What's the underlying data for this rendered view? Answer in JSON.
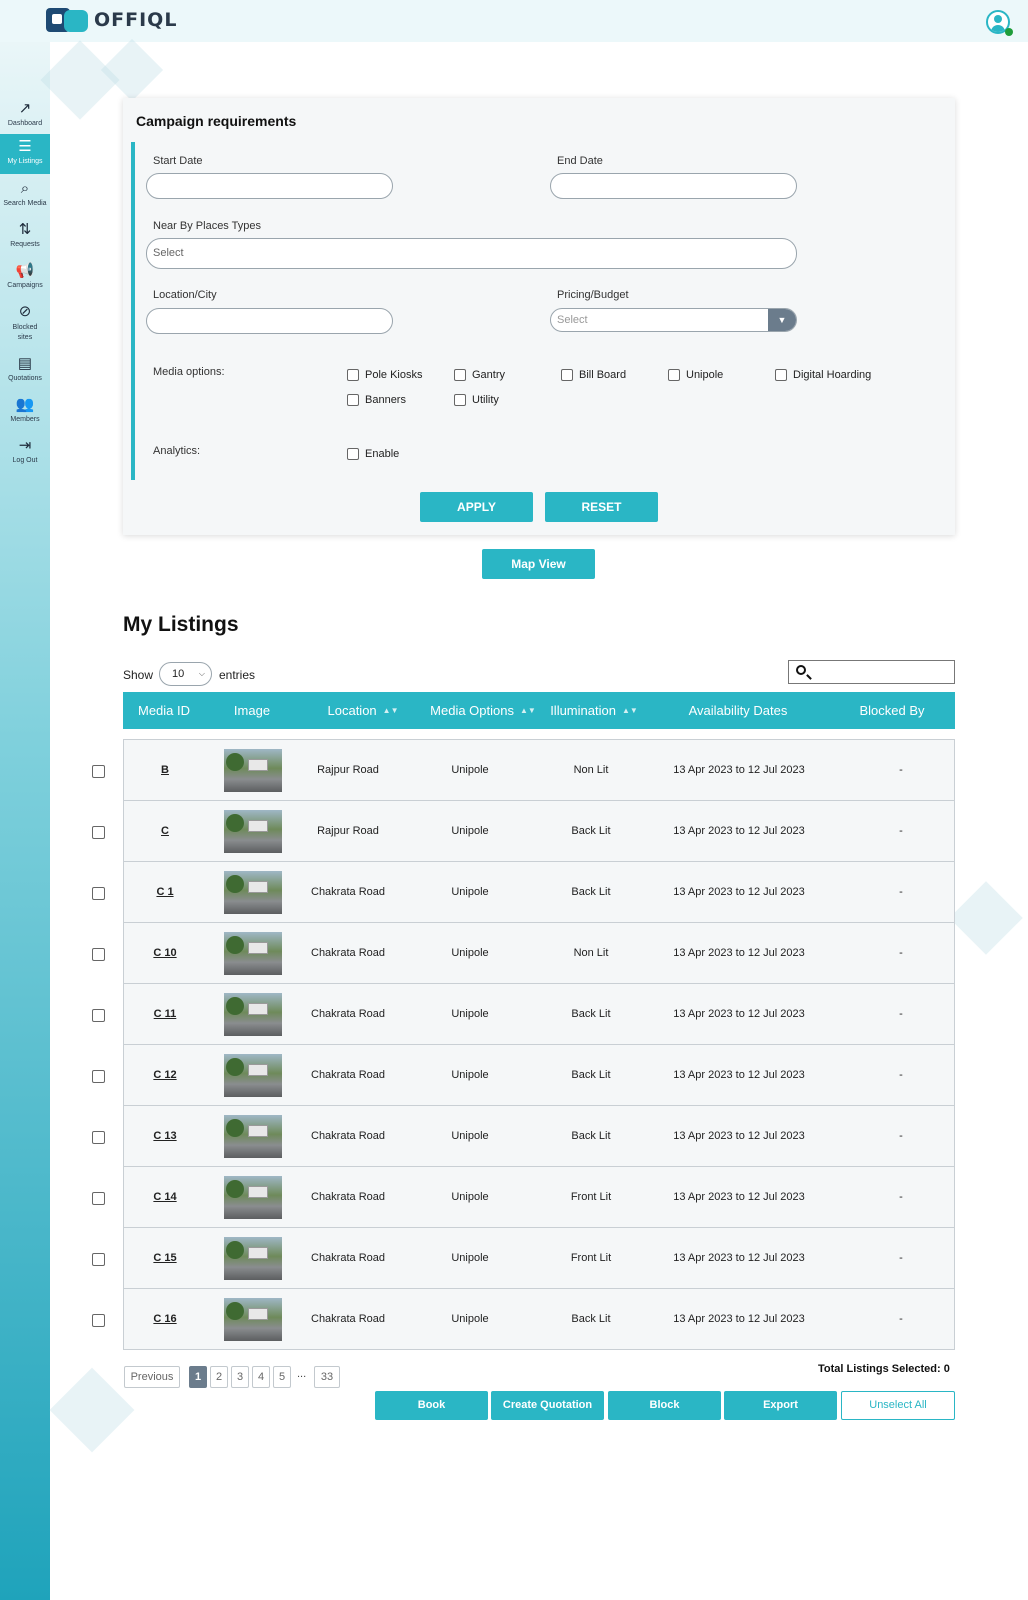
{
  "brand": {
    "name": "OFFIQL"
  },
  "sidebar": {
    "items": [
      {
        "key": "dashboard",
        "label": "Dashboard",
        "icon": "trending-up-icon"
      },
      {
        "key": "my-listings",
        "label": "My Listings",
        "icon": "list-icon",
        "active": true
      },
      {
        "key": "search-media",
        "label": "Search Media",
        "icon": "search-icon"
      },
      {
        "key": "requests",
        "label": "Requests",
        "icon": "sort-list-icon"
      },
      {
        "key": "campaigns",
        "label": "Campaigns",
        "icon": "megaphone-icon"
      },
      {
        "key": "blocked-sites",
        "label": "Blocked sites",
        "icon": "blocked-icon"
      },
      {
        "key": "quotations",
        "label": "Quotations",
        "icon": "invoice-icon"
      },
      {
        "key": "members",
        "label": "Members",
        "icon": "group-icon"
      },
      {
        "key": "log-out",
        "label": "Log Out",
        "icon": "logout-icon"
      }
    ]
  },
  "campaign": {
    "title": "Campaign requirements",
    "start_date_label": "Start Date",
    "start_date_value": "",
    "end_date_label": "End Date",
    "end_date_value": "",
    "nearby_label": "Near By Places Types",
    "nearby_placeholder": "Select",
    "location_label": "Location/City",
    "location_value": "",
    "pricing_label": "Pricing/Budget",
    "pricing_placeholder": "Select",
    "media_options_label": "Media options:",
    "media_options": [
      "Pole Kiosks",
      "Gantry",
      "Bill Board",
      "Unipole",
      "Digital Hoarding",
      "Banners",
      "Utility"
    ],
    "analytics_label": "Analytics:",
    "analytics_option": "Enable",
    "apply_label": "APPLY",
    "reset_label": "RESET"
  },
  "map_view_label": "Map View",
  "listings": {
    "title": "My Listings",
    "show_label": "Show",
    "entries_value": "10",
    "entries_label": "entries",
    "columns": [
      "Media ID",
      "Image",
      "Location",
      "Media Options",
      "Illumination",
      "Availability Dates",
      "Blocked By"
    ],
    "rows": [
      {
        "id": "B",
        "location": "Rajpur Road",
        "media": "Unipole",
        "illumination": "Non Lit",
        "dates": "13 Apr 2023 to 12 Jul 2023",
        "blocked": "-"
      },
      {
        "id": "C",
        "location": "Rajpur Road",
        "media": "Unipole",
        "illumination": "Back Lit",
        "dates": "13 Apr 2023 to 12 Jul 2023",
        "blocked": "-"
      },
      {
        "id": "C 1",
        "location": "Chakrata Road",
        "media": "Unipole",
        "illumination": "Back Lit",
        "dates": "13 Apr 2023 to 12 Jul 2023",
        "blocked": "-"
      },
      {
        "id": "C 10",
        "location": "Chakrata Road",
        "media": "Unipole",
        "illumination": "Non Lit",
        "dates": "13 Apr 2023 to 12 Jul 2023",
        "blocked": "-"
      },
      {
        "id": "C 11",
        "location": "Chakrata Road",
        "media": "Unipole",
        "illumination": "Back Lit",
        "dates": "13 Apr 2023 to 12 Jul 2023",
        "blocked": "-"
      },
      {
        "id": "C 12",
        "location": "Chakrata Road",
        "media": "Unipole",
        "illumination": "Back Lit",
        "dates": "13 Apr 2023 to 12 Jul 2023",
        "blocked": "-"
      },
      {
        "id": "C 13",
        "location": "Chakrata Road",
        "media": "Unipole",
        "illumination": "Back Lit",
        "dates": "13 Apr 2023 to 12 Jul 2023",
        "blocked": "-"
      },
      {
        "id": "C 14",
        "location": "Chakrata Road",
        "media": "Unipole",
        "illumination": "Front Lit",
        "dates": "13 Apr 2023 to 12 Jul 2023",
        "blocked": "-"
      },
      {
        "id": "C 15",
        "location": "Chakrata Road",
        "media": "Unipole",
        "illumination": "Front Lit",
        "dates": "13 Apr 2023 to 12 Jul 2023",
        "blocked": "-"
      },
      {
        "id": "C 16",
        "location": "Chakrata Road",
        "media": "Unipole",
        "illumination": "Back Lit",
        "dates": "13 Apr 2023 to 12 Jul 2023",
        "blocked": "-"
      }
    ]
  },
  "pagination": {
    "previous_label": "Previous",
    "pages": [
      "1",
      "2",
      "3",
      "4",
      "5"
    ],
    "current": "1",
    "ellipsis": "...",
    "last": "33"
  },
  "total_selected_label": "Total Listings Selected: 0",
  "actions": {
    "book": "Book",
    "create_quotation": "Create Quotation",
    "block": "Block",
    "export": "Export",
    "unselect_all": "Unselect All"
  },
  "colors": {
    "accent": "#2ab6c5",
    "header_bg": "#ecf8fa",
    "muted_button": "#6b7c8c",
    "online": "#1f9d3a"
  }
}
